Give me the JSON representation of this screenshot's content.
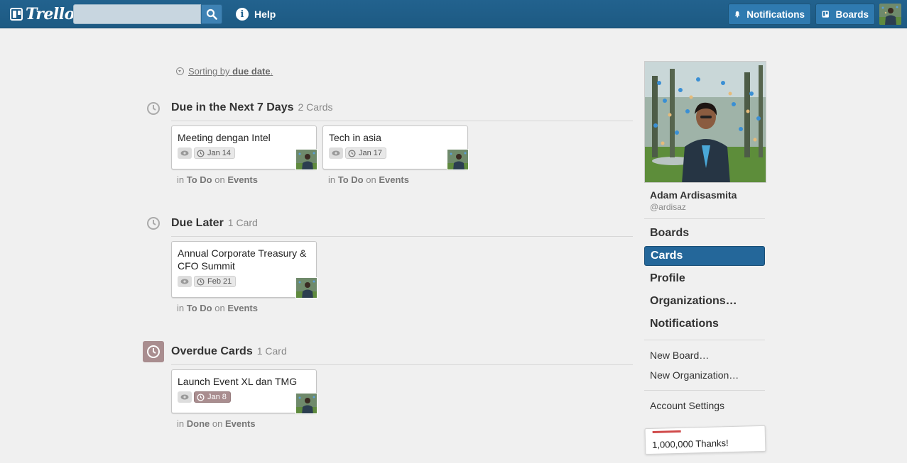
{
  "header": {
    "logo_text": "Trello",
    "search_placeholder": "",
    "help_label": "Help",
    "notifications_label": "Notifications",
    "boards_label": "Boards"
  },
  "sorting": {
    "prefix": "Sorting by ",
    "key": "due date",
    "suffix": "."
  },
  "sections": [
    {
      "title": "Due in the Next 7 Days",
      "count": "2 Cards",
      "cards": [
        {
          "title": "Meeting dengan Intel",
          "due": "Jan 14",
          "list": "To Do",
          "board": "Events"
        },
        {
          "title": "Tech in asia",
          "due": "Jan 17",
          "list": "To Do",
          "board": "Events"
        }
      ]
    },
    {
      "title": "Due Later",
      "count": "1 Card",
      "cards": [
        {
          "title": "Annual Corporate Treasury & CFO Summit",
          "due": "Feb 21",
          "list": "To Do",
          "board": "Events"
        }
      ]
    },
    {
      "title": "Overdue Cards",
      "count": "1 Card",
      "cards": [
        {
          "title": "Launch Event XL dan TMG",
          "due": "Jan 8",
          "list": "Done",
          "board": "Events"
        }
      ]
    }
  ],
  "meta_words": {
    "in": "in",
    "on": "on"
  },
  "sidebar": {
    "name": "Adam Ardisasmita",
    "username": "@ardisaz",
    "nav": [
      "Boards",
      "Cards",
      "Profile",
      "Organizations…",
      "Notifications"
    ],
    "links": [
      "New Board…",
      "New Organization…"
    ],
    "account_settings": "Account Settings",
    "thanks": "1,000,000 Thanks!"
  },
  "colors": {
    "header": "#22628e",
    "active_nav": "#24679a",
    "overdue": "#a98d8f"
  }
}
